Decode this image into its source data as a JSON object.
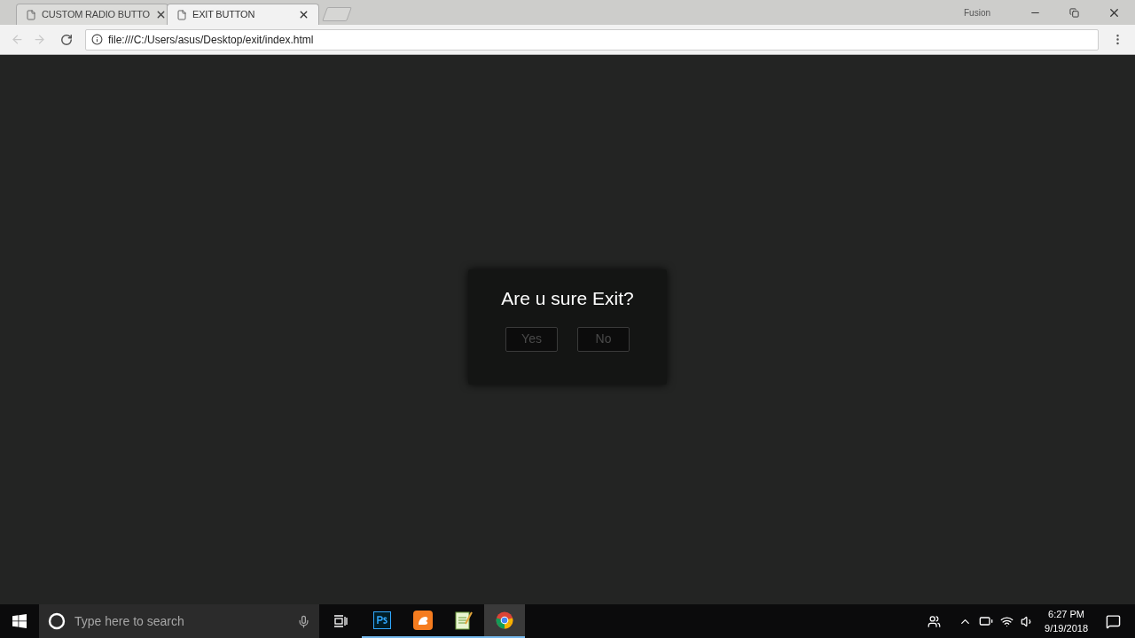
{
  "tabs": [
    {
      "title": "CUSTOM RADIO BUTTO",
      "selected": false
    },
    {
      "title": "EXIT BUTTON",
      "selected": true
    }
  ],
  "window": {
    "profile": "Fusion"
  },
  "address_bar": {
    "url": "file:///C:/Users/asus/Desktop/exit/index.html"
  },
  "dialog": {
    "title": "Are u sure Exit?",
    "buttons": [
      "Yes",
      "No"
    ]
  },
  "taskbar": {
    "search_placeholder": "Type here to search",
    "apps": [
      {
        "kind": "photoshop",
        "selected": false
      },
      {
        "kind": "uc",
        "selected": false
      },
      {
        "kind": "notepad",
        "selected": false
      },
      {
        "kind": "chrome",
        "selected": true
      }
    ],
    "time": "6:27 PM",
    "date": "9/19/2018"
  }
}
